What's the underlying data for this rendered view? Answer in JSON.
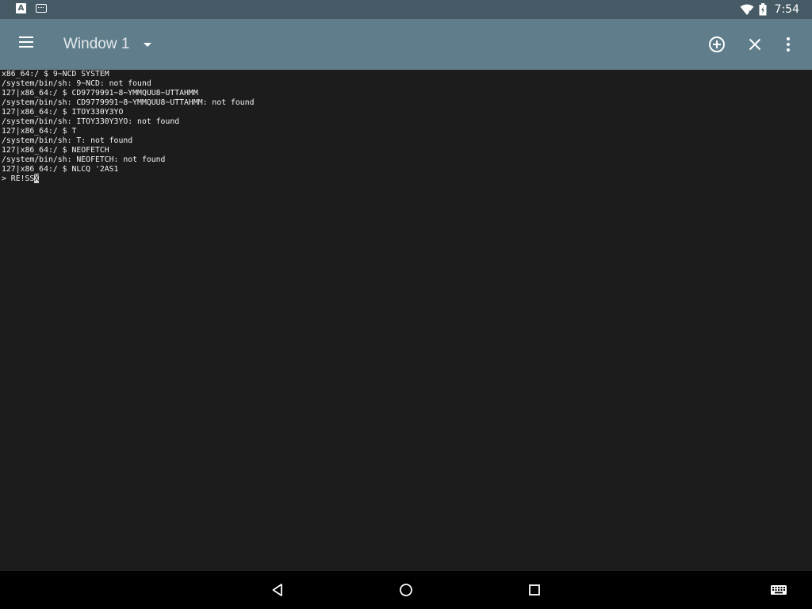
{
  "status_bar": {
    "time": "7:54",
    "notification_icons": [
      "a-notification-icon",
      "keyboard-notification-icon"
    ],
    "a_icon_letter": "A",
    "right_icons": [
      "wifi-icon",
      "battery-icon"
    ]
  },
  "app_bar": {
    "window_title": "Window 1",
    "actions": [
      "add-window-icon",
      "close-icon",
      "more-vert-icon"
    ]
  },
  "terminal": {
    "lines": [
      "x86_64:/ $ 9~NCD SYSTEM",
      "/system/bin/sh: 9~NCD: not found",
      "127|x86_64:/ $ CD9779991~8~YMMQUU8~UTTAHMM",
      "/system/bin/sh: CD9779991~8~YMMQUU8~UTTAHMM: not found",
      "127|x86_64:/ $ ITOY330Y3YO",
      "/system/bin/sh: ITOY330Y3YO: not found",
      "127|x86_64:/ $ T",
      "/system/bin/sh: T: not found",
      "127|x86_64:/ $ NEOFETCH",
      "/system/bin/sh: NEOFETCH: not found",
      "127|x86_64:/ $ NLCQ '2AS1"
    ],
    "current_input": "> RE!SS",
    "cursor_char": "X"
  },
  "nav_bar": {
    "buttons": [
      "back-icon",
      "home-icon",
      "recents-icon",
      "keyboard-icon"
    ]
  },
  "colors": {
    "status_bar": "#455a64",
    "app_bar": "#607d8b",
    "terminal_bg": "#1c1c1c",
    "terminal_fg": "#f2f2f2",
    "nav_bar": "#000000"
  }
}
